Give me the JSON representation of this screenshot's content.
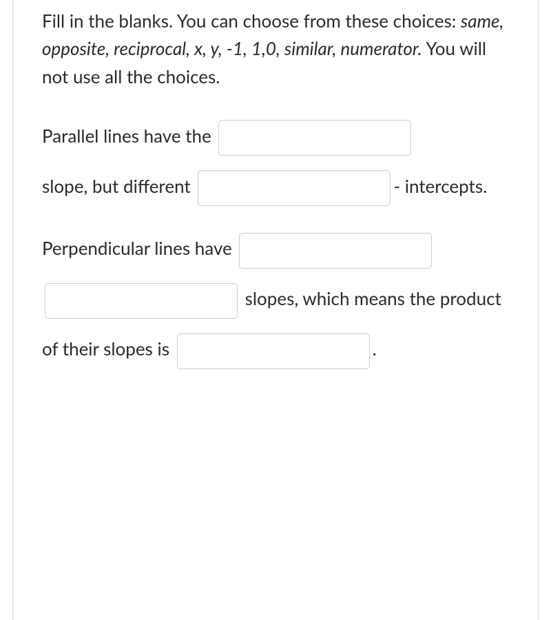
{
  "instructions": {
    "prefix": "Fill in the blanks.  You can choose from these choices: ",
    "choices": "same, opposite, reciprocal, x, y, -1, 1,0, similar, numerator.",
    "suffix": " You will not use all the choices."
  },
  "paragraph1": {
    "t1": "Parallel lines have the ",
    "blank1": "",
    "t2": "slope, but different ",
    "blank2": "",
    "t3": "-",
    "t4": "intercepts."
  },
  "paragraph2": {
    "t1": "Perpendicular lines have ",
    "blank3": "",
    "blank4": "",
    "t2": " slopes, which means the",
    "t3": "product of their slopes is",
    "blank5": "",
    "t4": "."
  }
}
